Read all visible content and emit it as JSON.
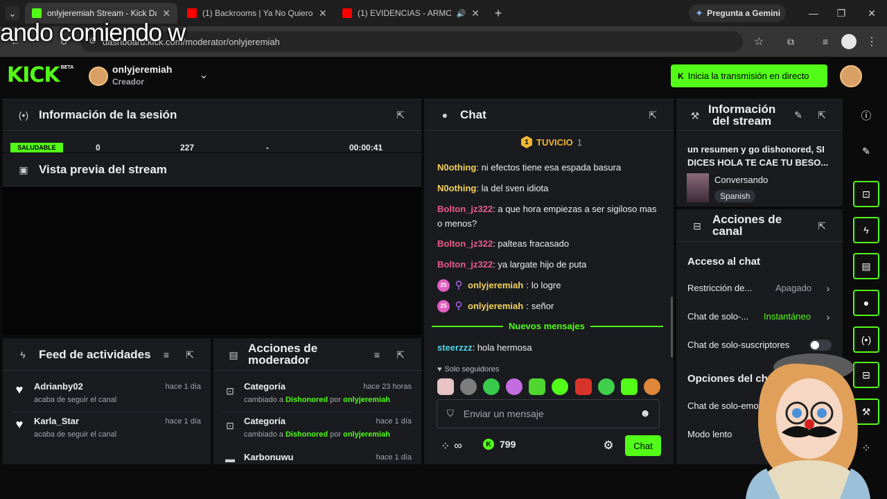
{
  "overlay": {
    "text": "ando comiendo w"
  },
  "browser": {
    "tabs": [
      {
        "title": "onlyjeremiah Stream - Kick Das",
        "active": true
      },
      {
        "title": "(1) Backrooms | Ya No Quiero I",
        "active": false
      },
      {
        "title": "(1) EVIDENCIAS - ARMONIA",
        "active": false
      }
    ],
    "gemini_label": "Pregunta a Gemini",
    "url": "dashboard.kick.com/moderator/onlyjeremiah"
  },
  "header": {
    "logo": "KICK",
    "logo_badge": "BETA",
    "channel_name": "onlyjeremiah",
    "channel_role": "Creador",
    "go_live_label": "Inicia la transmisión en directo"
  },
  "session": {
    "title": "Información de la sesión",
    "status": "SALUDABLE",
    "stats": [
      "0",
      "227",
      "-",
      "00:00:41"
    ]
  },
  "preview": {
    "title": "Vista previa del stream"
  },
  "feed": {
    "title": "Feed de actividades",
    "items": [
      {
        "user": "Adrianby02",
        "desc": "acaba de seguir el canal",
        "time": "hace 1 día"
      },
      {
        "user": "Karla_Star",
        "desc": "acaba de seguir el canal",
        "time": "hace 1 día"
      }
    ]
  },
  "modactions": {
    "title_line1": "Acciones de",
    "title_line2": "moderador",
    "items": [
      {
        "label": "Categoría",
        "time": "hace 23 horas",
        "prefix": "cambiado a",
        "value": "Dishonored",
        "by": "por",
        "user": "onlyjeremiah"
      },
      {
        "label": "Categoría",
        "time": "hace 1 día",
        "prefix": "cambiado a",
        "value": "Dishonored",
        "by": "por",
        "user": "onlyjeremiah"
      },
      {
        "label": "Karbonuwu",
        "time": "hace 1 día"
      }
    ]
  },
  "chat": {
    "title": "Chat",
    "pinned_user": "TUVICIO",
    "pinned_count": "1",
    "messages": [
      {
        "user": "N0othing",
        "text": "ni efectos tiene esa espada basura"
      },
      {
        "user": "N0othing",
        "text": "la del sven idiota"
      },
      {
        "user": "Bolton_jz322",
        "text": "a que hora empiezas a ser sigiloso mas o menos?"
      },
      {
        "user": "Bolton_jz322",
        "text": "palteas fracasado"
      },
      {
        "user": "Bolton_jz322",
        "text": "ya largate hijo de puta"
      },
      {
        "badge": "25",
        "user": "onlyjeremiah",
        "text": "lo logre"
      },
      {
        "badge": "25",
        "user": "onlyjeremiah",
        "text": "señor"
      }
    ],
    "new_messages_label": "Nuevos mensajes",
    "new_message": {
      "user": "steerzzz",
      "text": "hola hermosa"
    },
    "followers_only": "Solo seguidores",
    "input_placeholder": "Enviar un mensaje",
    "points": "799",
    "send_label": "Chat"
  },
  "streaminfo": {
    "title_line1": "Información",
    "title_line2": "del stream",
    "description": "un resumen y go dishonored, SI DICES HOLA TE CAE TU BESO...",
    "category": "Conversando",
    "language": "Spanish"
  },
  "channelactions": {
    "title_line1": "Acciones de",
    "title_line2": "canal",
    "chat_access": "Acceso al chat",
    "rows": [
      {
        "label": "Restricción de...",
        "value": "Apagado"
      },
      {
        "label": "Chat de solo-...",
        "value": "Instantáneo"
      },
      {
        "label": "Chat de solo-suscriptores",
        "value": ""
      }
    ],
    "options_title": "Opciones del chat",
    "option_rows": [
      "Chat de solo-emotes",
      "Modo lento"
    ]
  },
  "colors": {
    "accent": "#53fc18",
    "panel": "#191b1f",
    "bg": "#0b0b0b"
  }
}
